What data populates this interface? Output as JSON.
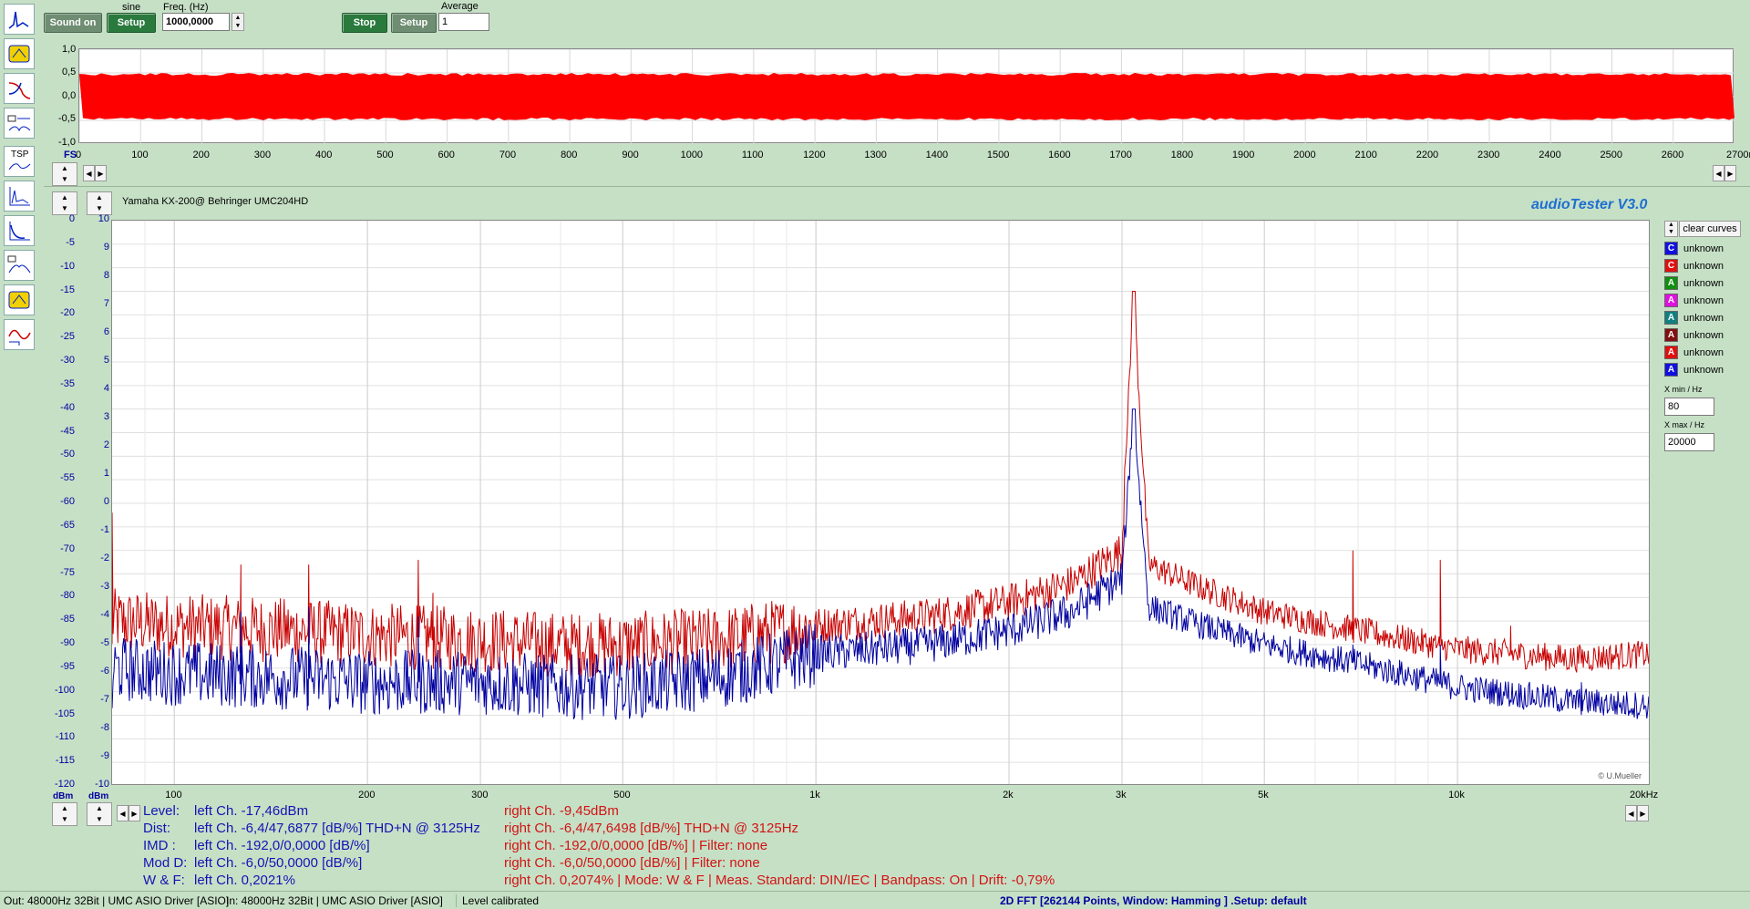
{
  "toolbar": {
    "sound_on_label": "Sound on",
    "waveform_label": "sine",
    "gen_setup_label": "Setup",
    "freq_label": "Freq. (Hz)",
    "freq_value": "1000,0000",
    "stop_label": "Stop",
    "ana_setup_label": "Setup",
    "average_label": "Average",
    "average_value": "1"
  },
  "waveform": {
    "y_labels": [
      "1,0",
      "0,5",
      "0,0",
      "-0,5",
      "-1,0"
    ],
    "fs_label": "FS",
    "x_labels": [
      "0",
      "100",
      "200",
      "300",
      "400",
      "500",
      "600",
      "700",
      "800",
      "900",
      "1000",
      "1100",
      "1200",
      "1300",
      "1400",
      "1500",
      "1600",
      "1700",
      "1800",
      "1900",
      "2000",
      "2100",
      "2200",
      "2300",
      "2400",
      "2500",
      "2600",
      "2700ms"
    ],
    "signal_color": "#ff0000"
  },
  "fft": {
    "device_title": "Yamaha KX-200@ Behringer UMC204HD",
    "app_brand": "audioTester  V3.0",
    "copyright": "© U.Mueller",
    "dbm_labels": [
      "0",
      "-5",
      "-10",
      "-15",
      "-20",
      "-25",
      "-30",
      "-35",
      "-40",
      "-45",
      "-50",
      "-55",
      "-60",
      "-65",
      "-70",
      "-75",
      "-80",
      "-85",
      "-90",
      "-95",
      "-100",
      "-105",
      "-110",
      "-115",
      "-120"
    ],
    "db_labels": [
      "10",
      "9",
      "8",
      "7",
      "6",
      "5",
      "4",
      "3",
      "2",
      "1",
      "0",
      "-1",
      "-2",
      "-3",
      "-4",
      "-5",
      "-6",
      "-7",
      "-8",
      "-9",
      "-10"
    ],
    "dbm_unit_left": "dBm",
    "dbm_unit_right": "dBm",
    "x_labels": [
      "100",
      "200",
      "300",
      "500",
      "1k",
      "2k",
      "3k",
      "5k",
      "10k",
      "20kHz"
    ],
    "clear_curves_label": "clear curves",
    "legend": [
      {
        "letter": "C",
        "color": "#1010e0",
        "label": "unknown"
      },
      {
        "letter": "C",
        "color": "#e01010",
        "label": "unknown"
      },
      {
        "letter": "A",
        "color": "#109010",
        "label": "unknown"
      },
      {
        "letter": "A",
        "color": "#e010e0",
        "label": "unknown"
      },
      {
        "letter": "A",
        "color": "#108080",
        "label": "unknown"
      },
      {
        "letter": "A",
        "color": "#801010",
        "label": "unknown"
      },
      {
        "letter": "A",
        "color": "#e01010",
        "label": "unknown"
      },
      {
        "letter": "A",
        "color": "#1010e0",
        "label": "unknown"
      }
    ],
    "xmin_label": "X min / Hz",
    "xmin_value": "80",
    "xmax_label": "X max / Hz",
    "xmax_value": "20000",
    "chart_data": {
      "type": "line",
      "xscale": "log",
      "xlim": [
        80,
        20000
      ],
      "ylim": [
        -120,
        0
      ],
      "yunit": "dBm",
      "series": [
        {
          "color": "#c80000",
          "peak_freq": 3125,
          "peak_level": -15,
          "noise_floor": [
            [
              80,
              -85
            ],
            [
              100,
              -86
            ],
            [
              150,
              -87
            ],
            [
              200,
              -88
            ],
            [
              300,
              -89
            ],
            [
              400,
              -90
            ],
            [
              500,
              -90
            ],
            [
              700,
              -89
            ],
            [
              1000,
              -86
            ],
            [
              1500,
              -84
            ],
            [
              2000,
              -81
            ],
            [
              2500,
              -77
            ],
            [
              3000,
              -70
            ],
            [
              3125,
              -15
            ],
            [
              3300,
              -73
            ],
            [
              4000,
              -78
            ],
            [
              5000,
              -83
            ],
            [
              7000,
              -87
            ],
            [
              10000,
              -91
            ],
            [
              15000,
              -93
            ],
            [
              20000,
              -92
            ]
          ],
          "spurs": [
            [
              80,
              -62
            ],
            [
              127,
              -73
            ],
            [
              162,
              -73
            ],
            [
              240,
              -72
            ],
            [
              253,
              -79
            ],
            [
              6870,
              -70
            ],
            [
              9400,
              -72
            ],
            [
              12100,
              -86
            ]
          ]
        },
        {
          "color": "#0000a0",
          "peak_freq": 3125,
          "peak_level": -40,
          "noise_floor": [
            [
              80,
              -95
            ],
            [
              100,
              -96
            ],
            [
              150,
              -97
            ],
            [
              200,
              -98
            ],
            [
              300,
              -98
            ],
            [
              400,
              -99
            ],
            [
              500,
              -99
            ],
            [
              700,
              -97
            ],
            [
              1000,
              -92
            ],
            [
              1500,
              -90
            ],
            [
              2000,
              -87
            ],
            [
              2500,
              -83
            ],
            [
              3000,
              -76
            ],
            [
              3125,
              -40
            ],
            [
              3300,
              -82
            ],
            [
              4000,
              -86
            ],
            [
              5000,
              -90
            ],
            [
              7000,
              -94
            ],
            [
              10000,
              -99
            ],
            [
              15000,
              -102
            ],
            [
              20000,
              -103
            ]
          ],
          "spurs": [
            [
              127,
              -83
            ],
            [
              162,
              -82
            ],
            [
              240,
              -84
            ],
            [
              6870,
              -90
            ],
            [
              9400,
              -90
            ],
            [
              15600,
              -98
            ]
          ]
        }
      ]
    }
  },
  "results": {
    "level_label": "Level:",
    "dist_label": "Dist:",
    "imd_label": "IMD  :",
    "modd_label": "Mod D:",
    "wf_label": "W & F:",
    "left_level": "left Ch. -17,46dBm",
    "left_dist": "left Ch. -6,4/47,6877 [dB/%] THD+N  @ 3125Hz",
    "left_imd": "left Ch. -192,0/0,0000 [dB/%]",
    "left_modd": "left Ch. -6,0/50,0000 [dB/%]",
    "left_wf": "left Ch. 0,2021%",
    "right_level": "right Ch. -9,45dBm",
    "right_dist": "right Ch. -6,4/47,6498 [dB/%] THD+N  @ 3125Hz",
    "right_imd": "right Ch. -192,0/0,0000 [dB/%] |   Filter: none",
    "right_modd": "right Ch. -6,0/50,0000 [dB/%] |   Filter: none",
    "right_wf": "right Ch. 0,2074%   | Mode: W & F | Meas. Standard: DIN/IEC | Bandpass: On | Drift: -0,79%"
  },
  "status": {
    "out": "Out: 48000Hz 32Bit  | UMC ASIO Driver [ASIO]",
    "in": "In: 48000Hz 32Bit  | UMC ASIO Driver [ASIO]",
    "calib": "Level calibrated",
    "fft_info": "2D FFT [262144 Points, Window: Hamming ]  .Setup:  default"
  }
}
